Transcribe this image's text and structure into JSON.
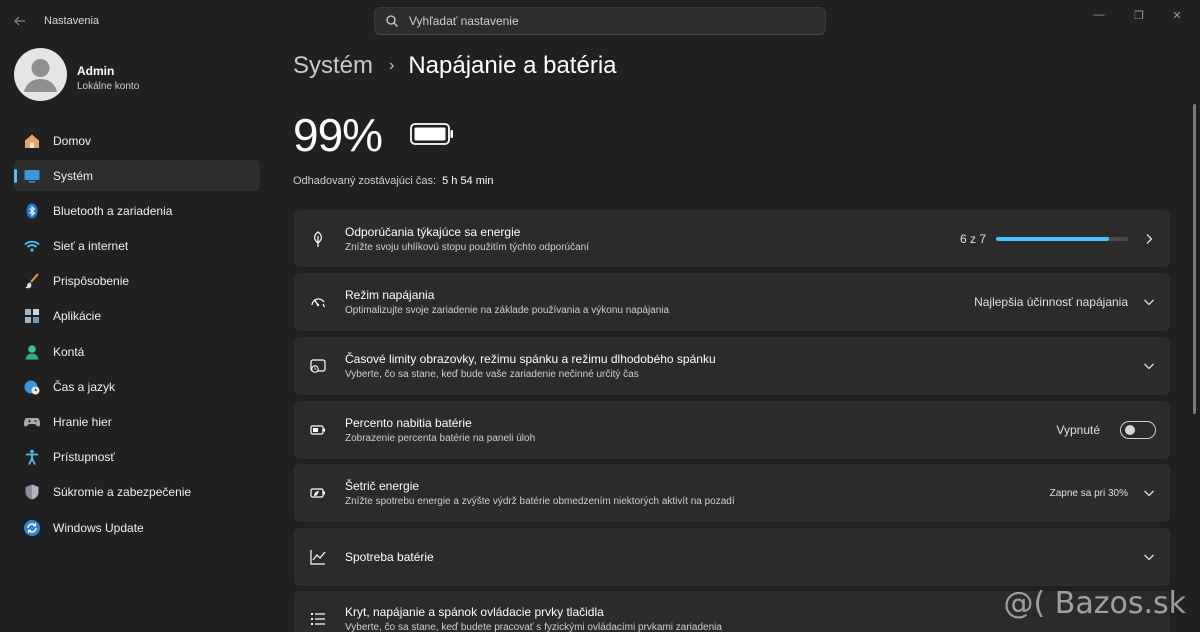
{
  "window": {
    "title": "Nastavenia",
    "search_placeholder": "Vyhľadať nastavenie",
    "controls": {
      "minimize": "—",
      "maximize": "❐",
      "close": "✕"
    }
  },
  "profile": {
    "name": "Admin",
    "account_type": "Lokálne konto"
  },
  "sidebar": {
    "items": [
      {
        "label": "Domov",
        "icon": "home-icon",
        "active": false
      },
      {
        "label": "Systém",
        "icon": "system-icon",
        "active": true
      },
      {
        "label": "Bluetooth a zariadenia",
        "icon": "bluetooth-icon",
        "active": false
      },
      {
        "label": "Sieť a internet",
        "icon": "wifi-icon",
        "active": false
      },
      {
        "label": "Prispôsobenie",
        "icon": "brush-icon",
        "active": false
      },
      {
        "label": "Aplikácie",
        "icon": "apps-icon",
        "active": false
      },
      {
        "label": "Kontá",
        "icon": "account-icon",
        "active": false
      },
      {
        "label": "Čas a jazyk",
        "icon": "clock-globe-icon",
        "active": false
      },
      {
        "label": "Hranie hier",
        "icon": "gamepad-icon",
        "active": false
      },
      {
        "label": "Prístupnosť",
        "icon": "accessibility-icon",
        "active": false
      },
      {
        "label": "Súkromie a zabezpečenie",
        "icon": "shield-icon",
        "active": false
      },
      {
        "label": "Windows Update",
        "icon": "update-icon",
        "active": false
      }
    ]
  },
  "breadcrumb": {
    "parent": "Systém",
    "separator": "›",
    "current": "Napájanie a batéria"
  },
  "battery": {
    "percent": "99%",
    "remaining_label": "Odhadovaný zostávajúci čas:",
    "remaining_value": "5 h 54 min"
  },
  "cards": {
    "energy": {
      "title": "Odporúčania týkajúce sa energie",
      "desc": "Znížte svoju uhlíkovú stopu použitím týchto odporúčaní",
      "value": "6 z 7",
      "progress": 0.857
    },
    "power_mode": {
      "title": "Režim napájania",
      "desc": "Optimalizujte svoje zariadenie na základe používania a výkonu napájania",
      "value": "Najlepšia účinnosť napájania"
    },
    "timeouts": {
      "title": "Časové limity obrazovky, režimu spánku a režimu dlhodobého spánku",
      "desc": "Vyberte, čo sa stane, keď bude vaše zariadenie nečinné určitý čas"
    },
    "battery_pct": {
      "title": "Percento nabitia batérie",
      "desc": "Zobrazenie percenta batérie na paneli úloh",
      "value": "Vypnuté",
      "toggle_on": false
    },
    "saver": {
      "title": "Šetrič energie",
      "desc": "Znížte spotrebu energie a zvýšte výdrž batérie obmedzením niektorých aktivít na pozadí",
      "value": "Zapne sa pri 30%"
    },
    "usage": {
      "title": "Spotreba batérie"
    },
    "lid": {
      "title": "Kryt, napájanie a spánok ovládacie prvky tlačidla",
      "desc": "Vyberte, čo sa stane, keď budete pracovať s fyzickými ovládacími prvkami zariadenia"
    }
  },
  "watermark": "@( Bazos.sk",
  "colors": {
    "accent": "#4cc2ff",
    "background": "#202020",
    "card": "#2b2b2b"
  }
}
